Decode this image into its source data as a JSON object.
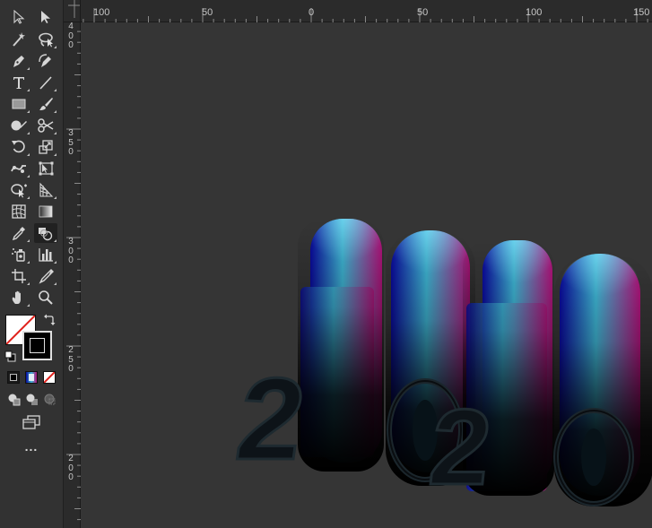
{
  "toolbar": {
    "tools": [
      {
        "name": "selection-tool"
      },
      {
        "name": "direct-selection-tool"
      },
      {
        "name": "magic-wand-tool"
      },
      {
        "name": "lasso-tool"
      },
      {
        "name": "pen-tool"
      },
      {
        "name": "curvature-tool"
      },
      {
        "name": "type-tool"
      },
      {
        "name": "line-segment-tool"
      },
      {
        "name": "rectangle-tool"
      },
      {
        "name": "paintbrush-tool"
      },
      {
        "name": "shaper-tool"
      },
      {
        "name": "scissors-tool"
      },
      {
        "name": "rotate-tool"
      },
      {
        "name": "scale-tool"
      },
      {
        "name": "puppet-warp-tool"
      },
      {
        "name": "free-transform-tool"
      },
      {
        "name": "shape-builder-tool"
      },
      {
        "name": "perspective-grid-tool"
      },
      {
        "name": "mesh-tool"
      },
      {
        "name": "gradient-tool"
      },
      {
        "name": "eyedropper-tool"
      },
      {
        "name": "blend-tool",
        "active": true
      },
      {
        "name": "symbol-sprayer-tool"
      },
      {
        "name": "column-graph-tool"
      },
      {
        "name": "artboard-tool"
      },
      {
        "name": "slice-tool"
      },
      {
        "name": "hand-tool"
      },
      {
        "name": "zoom-tool"
      }
    ],
    "fill_color": "none",
    "stroke_color": "#000000",
    "more_label": "..."
  },
  "rulers": {
    "horizontal": [
      "100",
      "50",
      "0",
      "50",
      "100",
      "150"
    ],
    "vertical": [
      "4\n0\n0",
      "3\n5\n0",
      "3\n0\n0",
      "2\n5\n0",
      "2\n0\n0"
    ]
  },
  "artwork": {
    "text": "2020",
    "gradient_colors": [
      "#0a0a9c",
      "#3fb8d6",
      "#b0127a"
    ]
  }
}
